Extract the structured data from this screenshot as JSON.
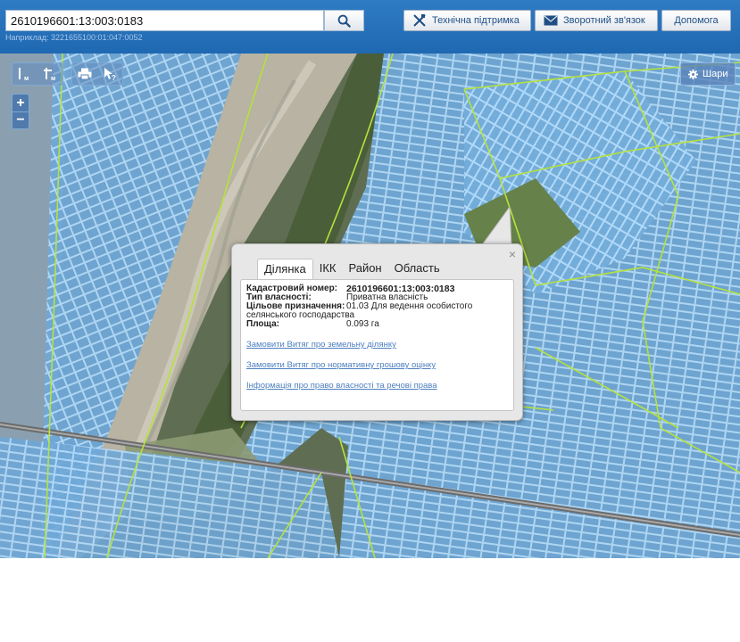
{
  "search": {
    "value": "2610196601:13:003:0183",
    "hint": "Наприклад: 3221655100:01:047:0052"
  },
  "header": {
    "support_label": "Технічна підтримка",
    "feedback_label": "Зворотний зв'язок",
    "help_label": "Допомога"
  },
  "map_tools": {
    "layers_label": "Шари"
  },
  "popup": {
    "tabs": [
      "Ділянка",
      "ІКК",
      "Район",
      "Область"
    ],
    "active_tab": "Ділянка",
    "fields": {
      "cadastral_label": "Кадастровий номер:",
      "cadastral_value": "2610196601:13:003:0183",
      "ownership_label": "Тип власності:",
      "ownership_value": "Приватна власність",
      "purpose_label": "Цільове призначення:",
      "purpose_value": "01.03 Для ведення особистого",
      "purpose_value_cont": "селянського господарства",
      "area_label": "Площа:",
      "area_value": "0.093 га"
    },
    "links": [
      "Замовити Витяг про земельну ділянку",
      "Замовити Витяг про нормативну грошову оцінку",
      "Інформація про право власності та речові права"
    ]
  },
  "colors": {
    "header": "#2f7bc4",
    "parcel_fill": "#7fb8e6",
    "parcel_stroke": "#a9d6ff",
    "boundary": "#b6e23c",
    "link": "#4d7fbf"
  }
}
